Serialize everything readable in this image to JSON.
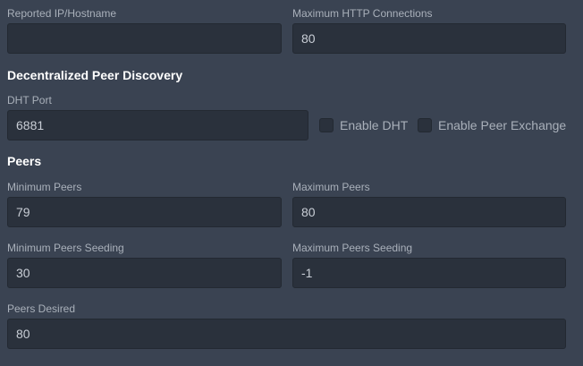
{
  "connection": {
    "reported_ip_label": "Reported IP/Hostname",
    "reported_ip_value": "",
    "max_http_label": "Maximum HTTP Connections",
    "max_http_value": "80"
  },
  "dht": {
    "section_title": "Decentralized Peer Discovery",
    "port_label": "DHT Port",
    "port_value": "6881",
    "enable_dht_label": "Enable DHT",
    "enable_dht_checked": false,
    "enable_pex_label": "Enable Peer Exchange",
    "enable_pex_checked": false
  },
  "peers": {
    "section_title": "Peers",
    "min_peers_label": "Minimum Peers",
    "min_peers_value": "79",
    "max_peers_label": "Maximum Peers",
    "max_peers_value": "80",
    "min_seeding_label": "Minimum Peers Seeding",
    "min_seeding_value": "30",
    "max_seeding_label": "Maximum Peers Seeding",
    "max_seeding_value": "-1",
    "desired_label": "Peers Desired",
    "desired_value": "80"
  },
  "colors": {
    "background": "#3a4352",
    "field_background": "#2a313c",
    "label_text": "#a9b0ba",
    "section_text": "#ffffff"
  }
}
